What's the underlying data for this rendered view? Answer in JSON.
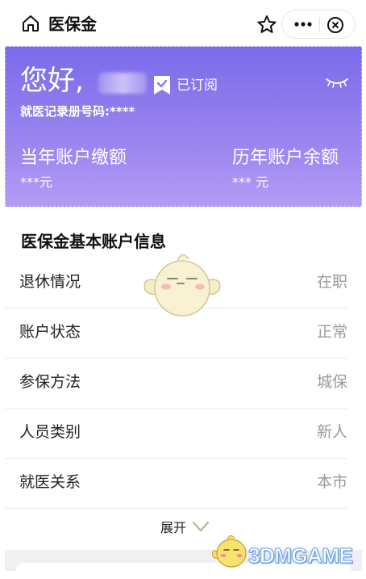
{
  "navbar": {
    "title": "医保金",
    "home_icon": "home-icon",
    "favorite_icon": "star-icon",
    "more_icon": "more-dots-icon",
    "close_icon": "close-circle-icon"
  },
  "hero": {
    "greeting": "您好,",
    "subscribed_label": "已订阅",
    "record_number": "就医记录册号码:****",
    "current_year_label": "当年账户缴额",
    "current_year_value": "***元",
    "history_label": "历年账户余额",
    "history_value": "*** 元",
    "colors": {
      "gradient_top": "#7a6be9",
      "gradient_bottom": "#b39cf4"
    }
  },
  "section": {
    "title": "医保金基本账户信息",
    "rows": [
      {
        "label": "退休情况",
        "value": "在职"
      },
      {
        "label": "账户状态",
        "value": "正常"
      },
      {
        "label": "参保方法",
        "value": "城保"
      },
      {
        "label": "人员类别",
        "value": "新人"
      },
      {
        "label": "就医关系",
        "value": "本市"
      }
    ],
    "expand_label": "展开"
  },
  "watermark": {
    "text": "3DMGAME"
  }
}
